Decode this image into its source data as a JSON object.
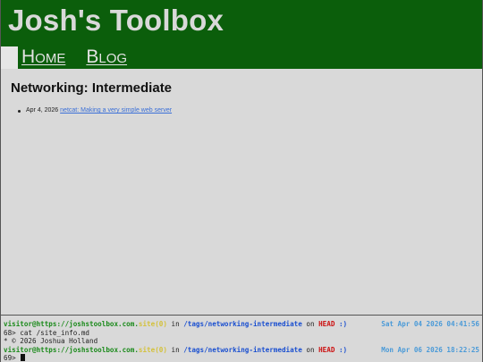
{
  "header": {
    "site_title": "Josh's Toolbox",
    "nav": [
      {
        "label": "Home"
      },
      {
        "label": "Blog"
      }
    ]
  },
  "main": {
    "heading": "Networking: Intermediate",
    "posts": [
      {
        "date": "Apr 4, 2026",
        "title": "netcat: Making a very simple web server"
      }
    ]
  },
  "terminal": {
    "prompt1": {
      "user": "visitor",
      "at": "@",
      "site": "https://joshstoolbox.com",
      "dot": ".",
      "git": "site(0)",
      "in_word": " in ",
      "path": "/tags/networking-intermediate",
      "on_word": " on ",
      "branch": "HEAD",
      "smile": " :)",
      "timestamp": "Sat Apr 04 2026 04:41:56"
    },
    "command_line": "68> cat /site_info.md",
    "output_line": "* © 2026 Joshua Holland",
    "prompt2": {
      "user": "visitor",
      "at": "@",
      "site": "https://joshstoolbox.com",
      "dot": ".",
      "git": "site(0)",
      "in_word": " in ",
      "path": "/tags/networking-intermediate",
      "on_word": " on ",
      "branch": "HEAD",
      "smile": " :)",
      "timestamp": "Mon Apr 06 2026 18:22:25"
    },
    "input_prompt": "69> ",
    "input_value": ""
  },
  "colors": {
    "header_bg": "#0b5e0b",
    "page_bg": "#d9d9d9",
    "link": "#3a6fd8",
    "term_green": "#1a8a1a",
    "term_yellow": "#d4c13a",
    "term_blue": "#1a4fd0",
    "term_red": "#cc1111",
    "term_timestamp": "#4a9ad8"
  }
}
